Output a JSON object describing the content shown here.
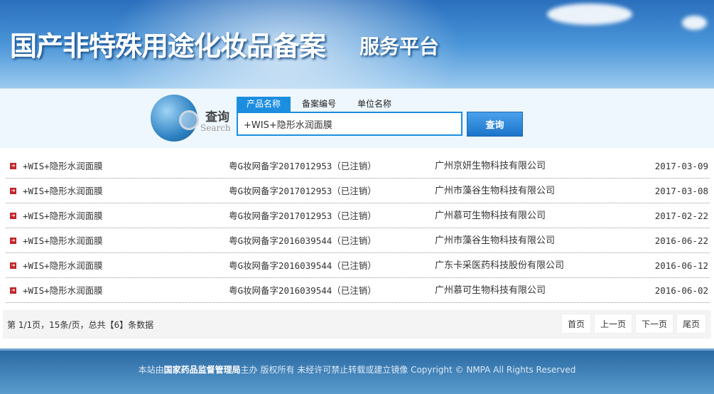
{
  "header": {
    "title": "国产非特殊用途化妆品备案",
    "subtitle": "服务平台"
  },
  "search": {
    "label_cn": "查询",
    "label_en": "Search",
    "tabs": [
      "产品名称",
      "备案编号",
      "单位名称"
    ],
    "active_tab": 0,
    "value": "+WIS+隐形水润面膜",
    "button": "查询"
  },
  "rows": [
    {
      "name": "+WIS+隐形水润面膜",
      "number": "粤G妆网备字2017012953（已注销）",
      "company": "广州京妍生物科技有限公司",
      "date": "2017-03-09"
    },
    {
      "name": "+WIS+隐形水润面膜",
      "number": "粤G妆网备字2017012953（已注销）",
      "company": "广州市藻谷生物科技有限公司",
      "date": "2017-03-08"
    },
    {
      "name": "+WIS+隐形水润面膜",
      "number": "粤G妆网备字2017012953（已注销）",
      "company": "广州慕可生物科技有限公司",
      "date": "2017-02-22"
    },
    {
      "name": "+WIS+隐形水润面膜",
      "number": "粤G妆网备字2016039544（已注销）",
      "company": "广州市藻谷生物科技有限公司",
      "date": "2016-06-22"
    },
    {
      "name": "+WIS+隐形水润面膜",
      "number": "粤G妆网备字2016039544（已注销）",
      "company": "广东卡采医药科技股份有限公司",
      "date": "2016-06-12"
    },
    {
      "name": "+WIS+隐形水润面膜",
      "number": "粤G妆网备字2016039544（已注销）",
      "company": "广州慕可生物科技有限公司",
      "date": "2016-06-02"
    }
  ],
  "pager": {
    "info": "第 1/1页，15条/页，总共【6】条数据",
    "first": "首页",
    "prev": "上一页",
    "next": "下一页",
    "last": "尾页"
  },
  "footer": {
    "prefix": "本站由",
    "org": "国家药品监督管理局",
    "suffix": "主办 版权所有 未经许可禁止转载或建立镜像 Copyright © NMPA All Rights Reserved"
  }
}
